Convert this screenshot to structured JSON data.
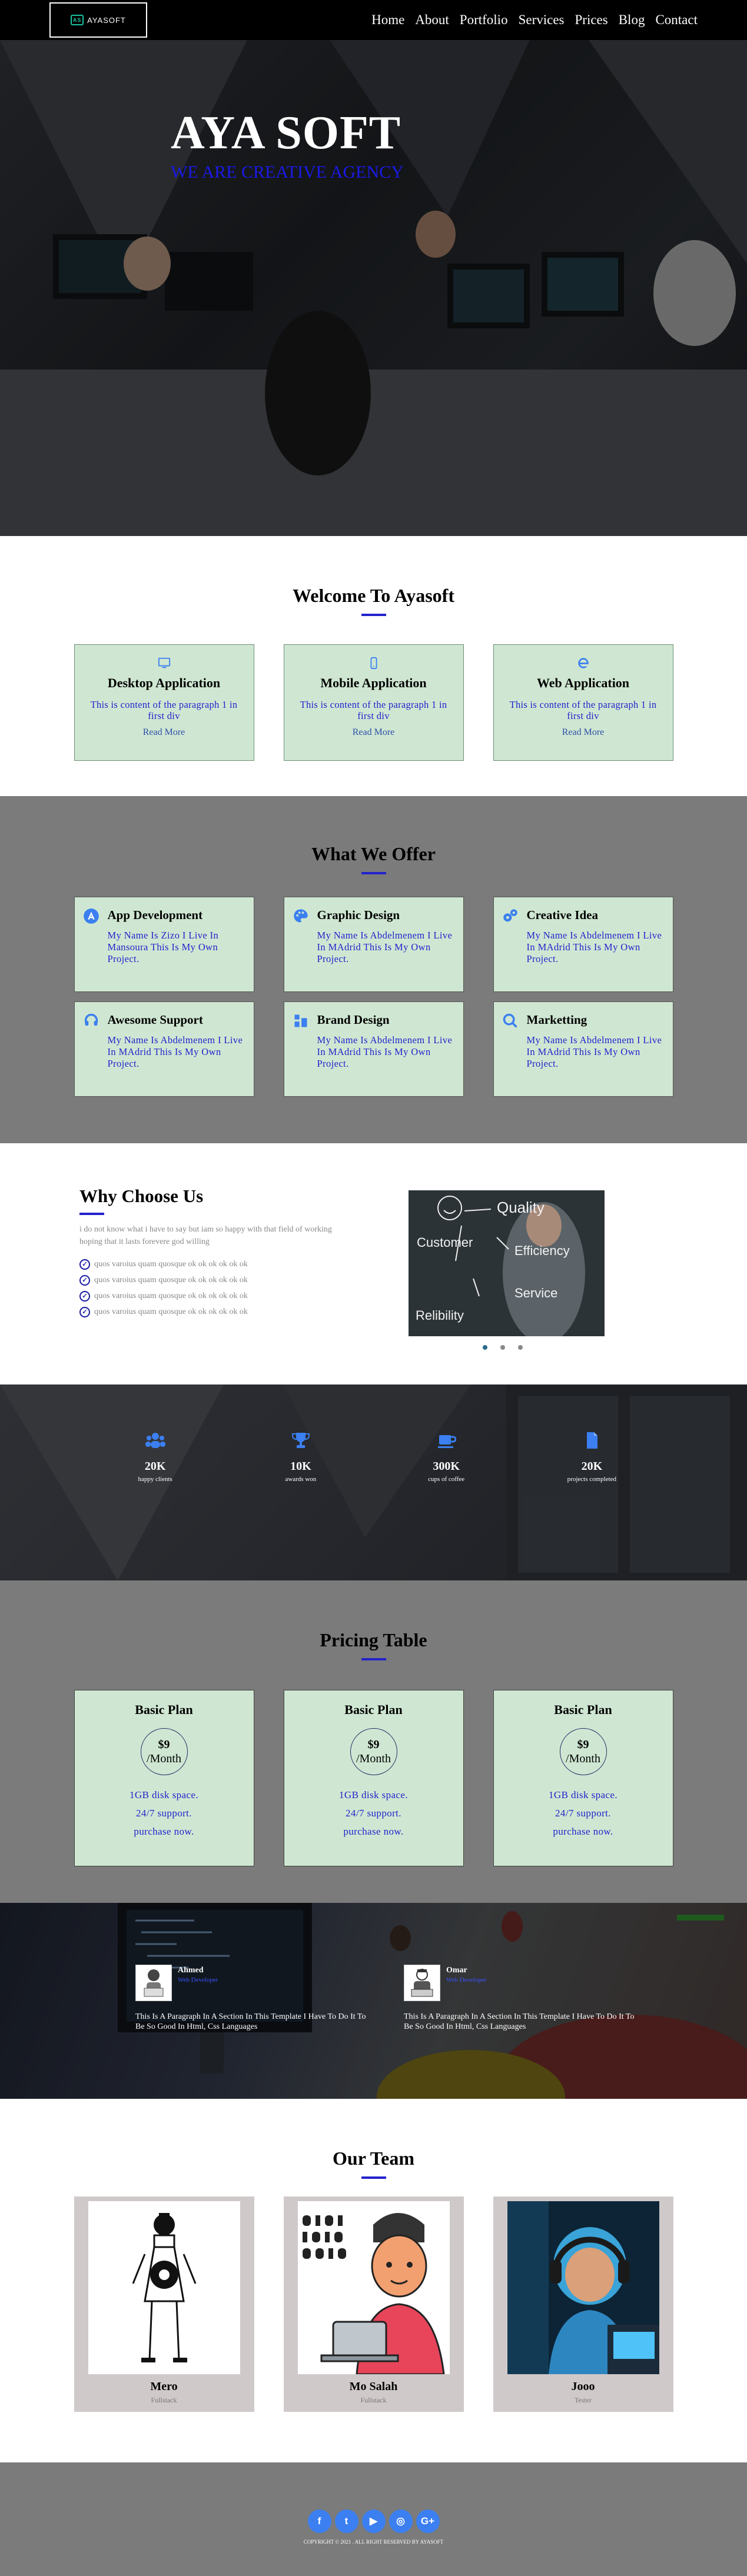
{
  "nav": {
    "logo_text": "AYASOFT",
    "logo_mark": "AS",
    "links": [
      "Home",
      "About",
      "Portfolio",
      "Services",
      "Prices",
      "Blog",
      "Contact"
    ]
  },
  "hero": {
    "title": "AYA SOFT",
    "subtitle": "WE ARE CREATIVE AGENCY"
  },
  "welcome": {
    "title": "Welcome To Ayasoft",
    "cards": [
      {
        "icon": "monitor-icon",
        "title": "Desktop Application",
        "text": "This is content of the paragraph 1 in first div",
        "link": "Read More"
      },
      {
        "icon": "mobile-icon",
        "title": "Mobile Application",
        "text": "This is content of the paragraph 1 in first div",
        "link": "Read More"
      },
      {
        "icon": "internet-explorer-icon",
        "title": "Web Application",
        "text": "This is content of the paragraph 1 in first div",
        "link": "Read More"
      }
    ]
  },
  "offer": {
    "title": "What We Offer",
    "items": [
      {
        "icon": "app-store-icon",
        "title": "App Development",
        "text": "My Name Is Zizo I Live In Mansoura This Is My Own Project."
      },
      {
        "icon": "palette-icon",
        "title": "Graphic Design",
        "text": "My Name Is Abdelmenem I Live In MAdrid This Is My Own Project."
      },
      {
        "icon": "gears-icon",
        "title": "Creative Idea",
        "text": "My Name Is Abdelmenem I Live In MAdrid This Is My Own Project."
      },
      {
        "icon": "headset-icon",
        "title": "Awesome Support",
        "text": "My Name Is Abdelmenem I Live In MAdrid This Is My Own Project."
      },
      {
        "icon": "brand-chart-icon",
        "title": "Brand Design",
        "text": "My Name Is Abdelmenem I Live In MAdrid This Is My Own Project."
      },
      {
        "icon": "magnifier-icon",
        "title": "Marketting",
        "text": "My Name Is Abdelmenem I Live In MAdrid This Is My Own Project."
      }
    ]
  },
  "why": {
    "title": "Why Choose Us",
    "lead": "i do not know what i have to say but iam so happy with that field of working hoping that it lasts forevere god willing",
    "points": [
      "quos varoius quam quosque ok ok ok ok ok ok",
      "quos varoius quam quosque ok ok ok ok ok ok",
      "quos varoius quam quosque ok ok ok ok ok ok",
      "quos varoius quam quosque ok ok ok ok ok ok"
    ],
    "board_words": [
      "Quality",
      "Customer",
      "Efficiency",
      "Service",
      "Relibility"
    ]
  },
  "stats": [
    {
      "icon": "users-icon",
      "num": "20K",
      "label": "happy clients"
    },
    {
      "icon": "trophy-icon",
      "num": "10K",
      "label": "awards won"
    },
    {
      "icon": "coffee-icon",
      "num": "300K",
      "label": "cups of coffee"
    },
    {
      "icon": "document-icon",
      "num": "20K",
      "label": "projects completed"
    }
  ],
  "pricing": {
    "title": "Pricing Table",
    "plans": [
      {
        "name": "Basic Plan",
        "price": "$9",
        "period": "/Month",
        "features": [
          "1GB disk space.",
          "24/7 support.",
          "purchase now."
        ]
      },
      {
        "name": "Basic Plan",
        "price": "$9",
        "period": "/Month",
        "features": [
          "1GB disk space.",
          "24/7 support.",
          "purchase now."
        ]
      },
      {
        "name": "Basic Plan",
        "price": "$9",
        "period": "/Month",
        "features": [
          "1GB disk space.",
          "24/7 support.",
          "purchase now."
        ]
      }
    ]
  },
  "testimonials": [
    {
      "name": "Ahmed",
      "role": "Web Developer",
      "text": "This Is A Paragraph In A Section In This Template I Have To Do It To Be So Good In Html, Css Languages"
    },
    {
      "name": "Omar",
      "role": "Web Developer",
      "text": "This Is A Paragraph In A Section In This Template I Have To Do It To Be So Good In Html, Css Languages"
    }
  ],
  "team": {
    "title": "Our Team",
    "members": [
      {
        "name": "Mero",
        "role": "Fullstack"
      },
      {
        "name": "Mo Salah",
        "role": "Fullstack"
      },
      {
        "name": "Jooo",
        "role": "Tester"
      }
    ]
  },
  "footer": {
    "socials": [
      "f",
      "t",
      "▶",
      "◎",
      "G+"
    ],
    "social_names": [
      "facebook-icon",
      "twitter-icon",
      "youtube-icon",
      "instagram-icon",
      "google-plus-icon"
    ],
    "copyright": "COPYRIGHT © 2021 . ALL RIGHT RESERVED BY AYASOFT"
  },
  "colors": {
    "card_bg": "#cfe7d2",
    "accent_blue": "#2222cc",
    "section_gray": "#7b7b7b",
    "icon_blue": "#3b7ff0"
  }
}
